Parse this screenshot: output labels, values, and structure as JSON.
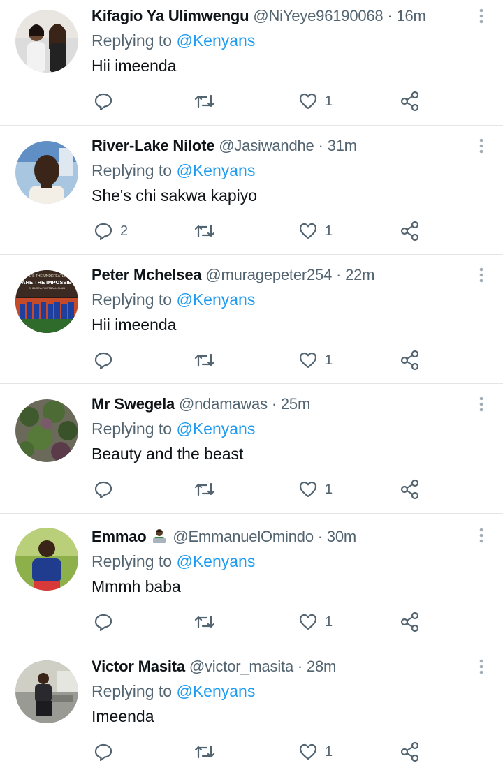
{
  "colors": {
    "link": "#1d9bf0",
    "muted": "#536471",
    "text": "#0f1419",
    "divider": "#e3e6e8"
  },
  "reply_prefix": "Replying to",
  "separator": "·",
  "tweets": [
    {
      "name": "Kifagio Ya Ulimwengu",
      "handle": "@NiYeye96190068",
      "time": "16m",
      "mention": "@Kenyans",
      "text": "Hii imeenda",
      "replies": "",
      "likes": "1",
      "avatar_icon": "two-women-photo"
    },
    {
      "name": "River-Lake Nilote",
      "handle": "@Jasiwandhe",
      "time": "31m",
      "mention": "@Kenyans",
      "text": "She's chi sakwa kapiyo",
      "replies": "2",
      "likes": "1",
      "avatar_icon": "man-portrait-photo"
    },
    {
      "name": "Peter Mchelsea",
      "handle": "@muragepeter254",
      "time": "22m",
      "mention": "@Kenyans",
      "text": "Hii imeenda",
      "replies": "",
      "likes": "1",
      "avatar_icon": "football-team-photo",
      "avatar_text": [
        "HE'S THE UNDEFEATED",
        "ARE THE IMPOSSIB",
        "CHELSEA FOOTBALL CLUB"
      ]
    },
    {
      "name": "Mr Swegela",
      "handle": "@ndamawas",
      "time": "25m",
      "mention": "@Kenyans",
      "text": "Beauty and the beast",
      "replies": "",
      "likes": "1",
      "avatar_icon": "plants-photo"
    },
    {
      "name": "Emmao",
      "name_emoji": "technologist-emoji",
      "handle": "@EmmanuelOmindo",
      "time": "30m",
      "mention": "@Kenyans",
      "text": "Mmmh baba",
      "replies": "",
      "likes": "1",
      "avatar_icon": "man-blue-shirt-photo"
    },
    {
      "name": "Victor Masita",
      "handle": "@victor_masita",
      "time": "28m",
      "mention": "@Kenyans",
      "text": "Imeenda",
      "replies": "",
      "likes": "1",
      "avatar_icon": "man-sitting-photo"
    }
  ]
}
